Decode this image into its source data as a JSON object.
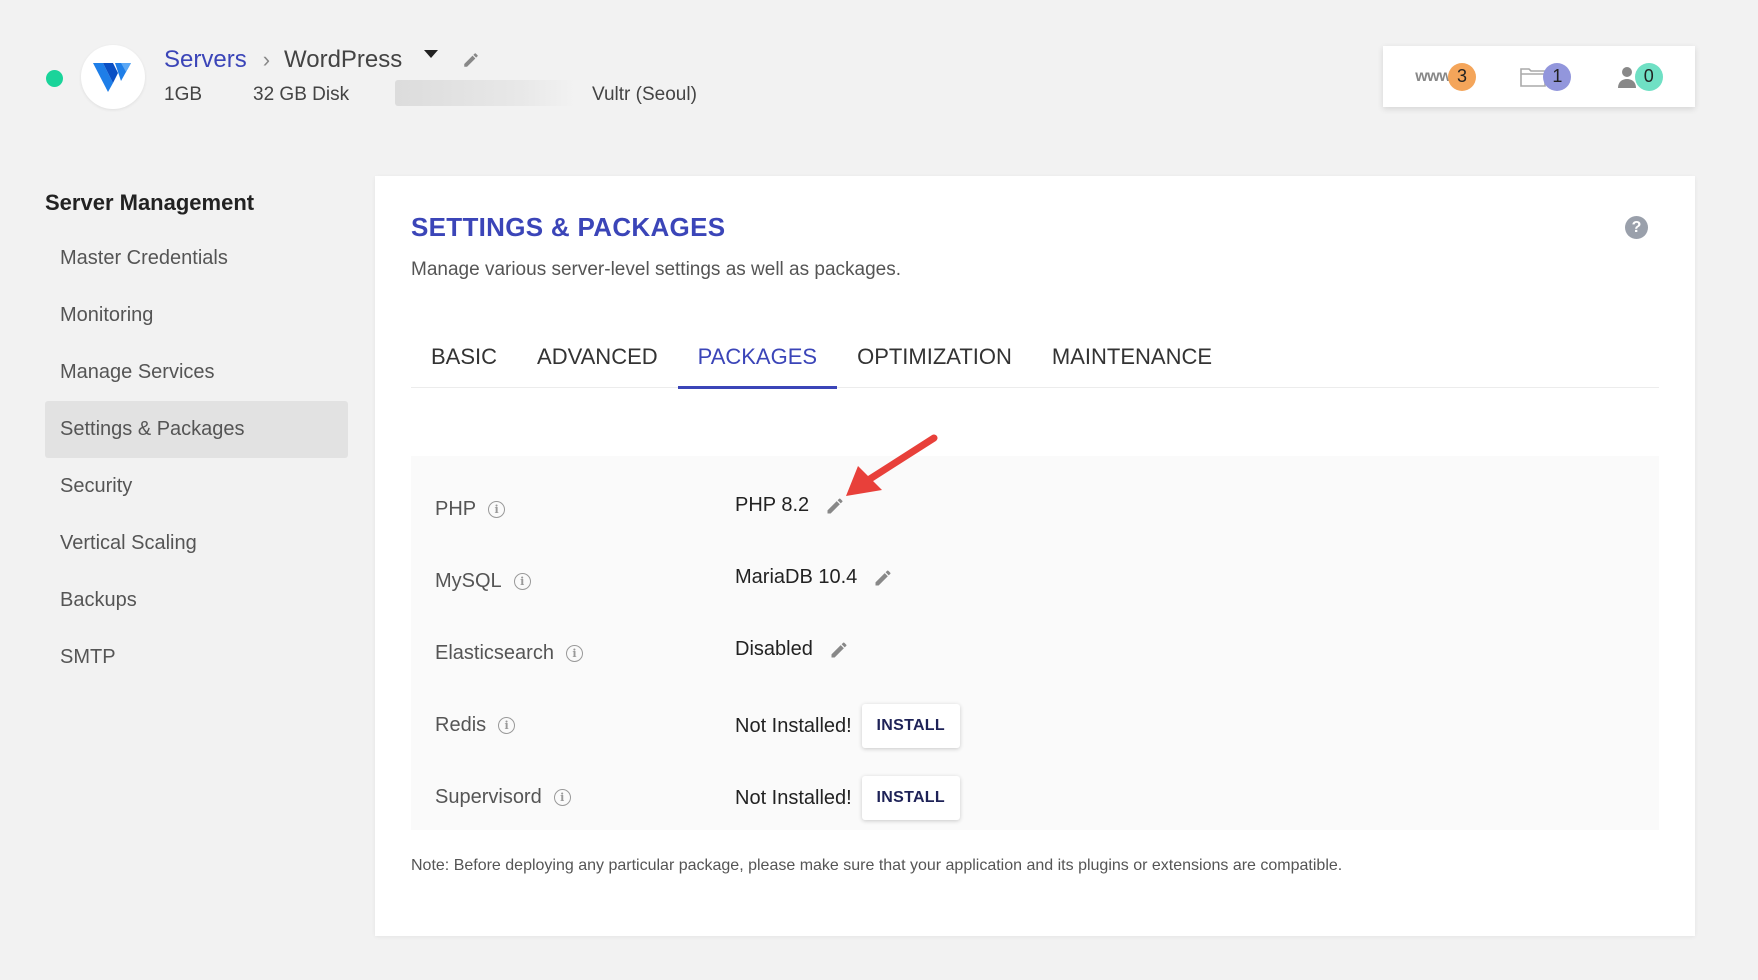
{
  "header": {
    "breadcrumb_parent": "Servers",
    "server_name": "WordPress",
    "ram": "1GB",
    "disk": "32 GB Disk",
    "provider": "Vultr (Seoul)",
    "status_color": "#1ad49a",
    "counters": [
      {
        "icon": "www-icon",
        "label": "www",
        "count": "3",
        "color": "#f4a55a"
      },
      {
        "icon": "folder-icon",
        "count": "1",
        "color": "#9296dc"
      },
      {
        "icon": "user-icon",
        "count": "0",
        "color": "#6fe0c4"
      }
    ]
  },
  "sidebar": {
    "title": "Server Management",
    "items": [
      {
        "label": "Master Credentials"
      },
      {
        "label": "Monitoring"
      },
      {
        "label": "Manage Services"
      },
      {
        "label": "Settings & Packages",
        "active": true
      },
      {
        "label": "Security"
      },
      {
        "label": "Vertical Scaling"
      },
      {
        "label": "Backups"
      },
      {
        "label": "SMTP"
      }
    ]
  },
  "main": {
    "title": "SETTINGS & PACKAGES",
    "subtitle": "Manage various server-level settings as well as packages.",
    "help_label": "?",
    "tabs": [
      {
        "label": "BASIC"
      },
      {
        "label": "ADVANCED"
      },
      {
        "label": "PACKAGES",
        "active": true
      },
      {
        "label": "OPTIMIZATION"
      },
      {
        "label": "MAINTENANCE"
      }
    ],
    "packages": [
      {
        "name": "PHP",
        "value": "PHP 8.2",
        "action": "edit"
      },
      {
        "name": "MySQL",
        "value": "MariaDB 10.4",
        "action": "edit"
      },
      {
        "name": "Elasticsearch",
        "value": "Disabled",
        "action": "edit"
      },
      {
        "name": "Redis",
        "value": "Not Installed!",
        "action": "install",
        "button": "INSTALL"
      },
      {
        "name": "Supervisord",
        "value": "Not Installed!",
        "action": "install",
        "button": "INSTALL"
      }
    ],
    "note": "Note: Before deploying any particular package, please make sure that your application and its plugins or extensions are compatible.",
    "accent_color": "#3b45b8",
    "annotation_arrow_color": "#e8403a"
  }
}
